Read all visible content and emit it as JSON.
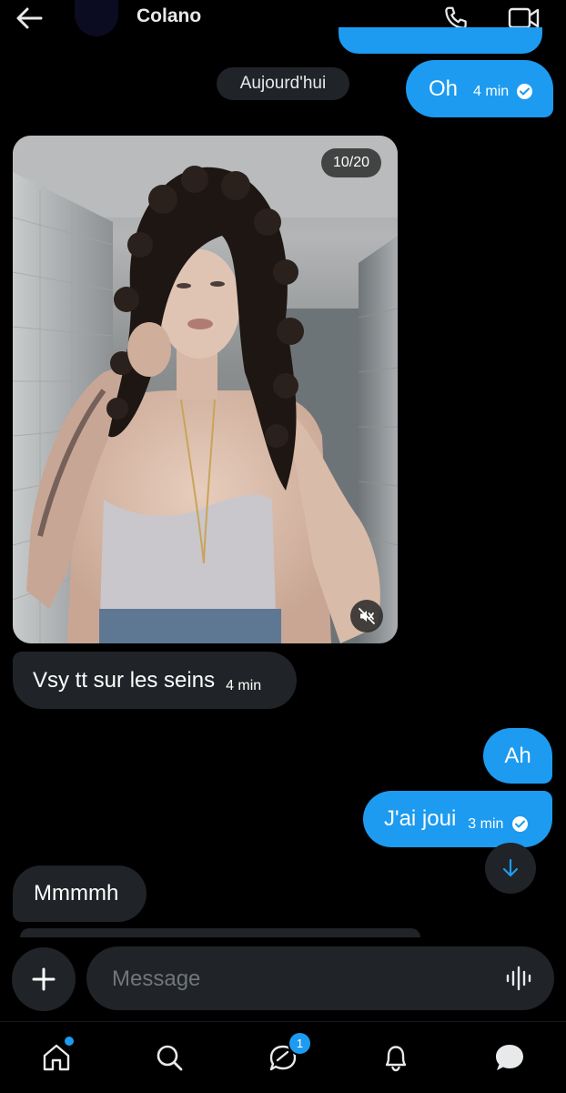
{
  "header": {
    "contact_name": "Colano"
  },
  "date_separator": "Aujourd'hui",
  "messages": [
    {
      "direction": "out",
      "text": "Oh",
      "time": "4 min",
      "status": "read"
    },
    {
      "direction": "in",
      "type": "media",
      "counter": "10/20",
      "muted": true
    },
    {
      "direction": "in",
      "text": "Vsy tt sur les seins",
      "time": "4 min"
    },
    {
      "direction": "out",
      "text": "Ah"
    },
    {
      "direction": "out",
      "text": "J'ai joui",
      "time": "3 min",
      "status": "read"
    },
    {
      "direction": "in",
      "text": "Mmmmh"
    }
  ],
  "composer": {
    "placeholder": "Message"
  },
  "nav": {
    "messages_badge": "1",
    "home_has_dot": true
  },
  "colors": {
    "accent": "#1d9bf0",
    "bubble_in": "#202327",
    "background": "#000000"
  },
  "icons": [
    "back-arrow-icon",
    "phone-icon",
    "video-camera-icon",
    "check-circle-icon",
    "mute-icon",
    "arrow-down-icon",
    "plus-icon",
    "voice-wave-icon",
    "home-icon",
    "search-icon",
    "messages-icon",
    "bell-icon",
    "chat-icon"
  ]
}
